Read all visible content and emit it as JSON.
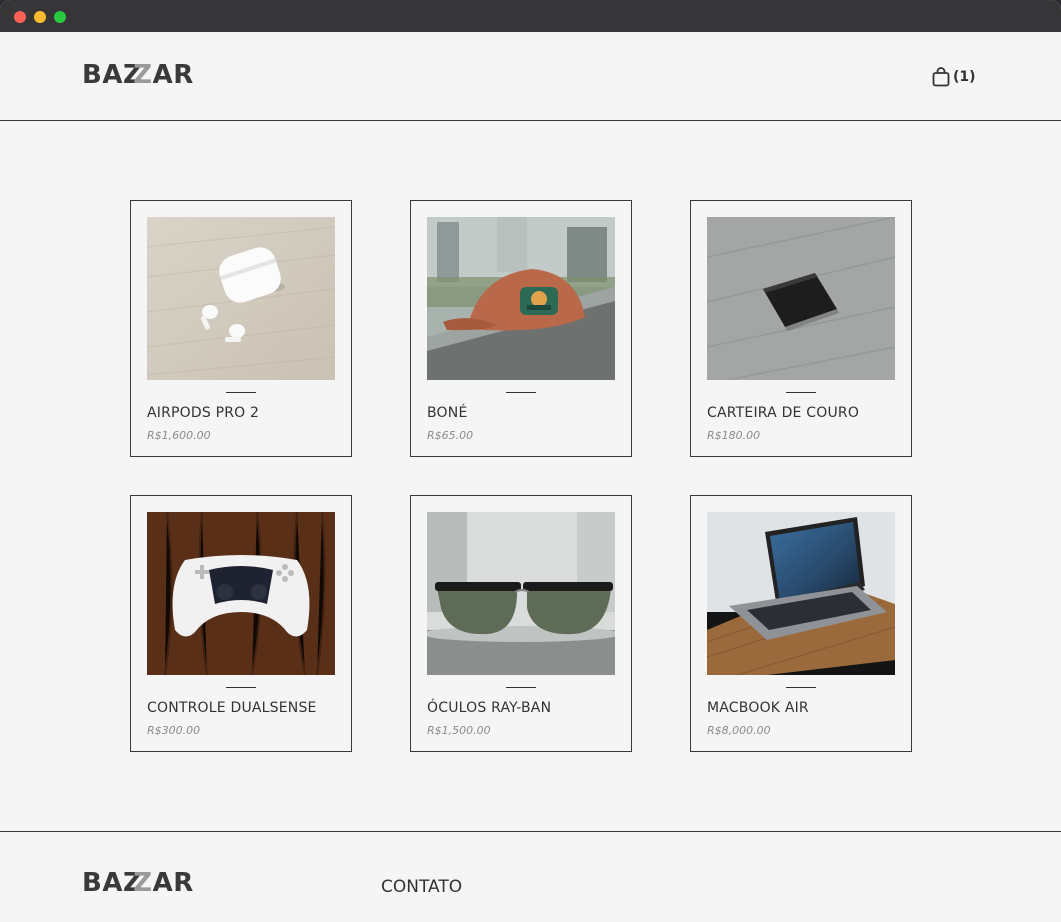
{
  "header": {
    "logo": {
      "part1": "BAZ",
      "part2": "Z",
      "part3": "AR"
    },
    "cart_count": "(1)"
  },
  "products": [
    {
      "name": "AIRPODS PRO 2",
      "price": "R$1,600.00",
      "image": "airpods-photo"
    },
    {
      "name": "BONÉ",
      "price": "R$65.00",
      "image": "cap-photo"
    },
    {
      "name": "CARTEIRA DE COURO",
      "price": "R$180.00",
      "image": "wallet-photo"
    },
    {
      "name": "CONTROLE DUALSENSE",
      "price": "R$300.00",
      "image": "controller-photo"
    },
    {
      "name": "ÓCULOS RAY-BAN",
      "price": "R$1,500.00",
      "image": "sunglasses-photo"
    },
    {
      "name": "MACBOOK AIR",
      "price": "R$8,000.00",
      "image": "laptop-photo"
    }
  ],
  "footer": {
    "logo": {
      "part1": "BAZ",
      "part2": "Z",
      "part3": "AR"
    },
    "contact_label": "CONTATO"
  },
  "colors": {
    "background": "#f5f5f5",
    "text": "#333333",
    "border": "#3a3a3a",
    "price": "#8a8a8a",
    "logo_accent": "#9a9a9a"
  }
}
